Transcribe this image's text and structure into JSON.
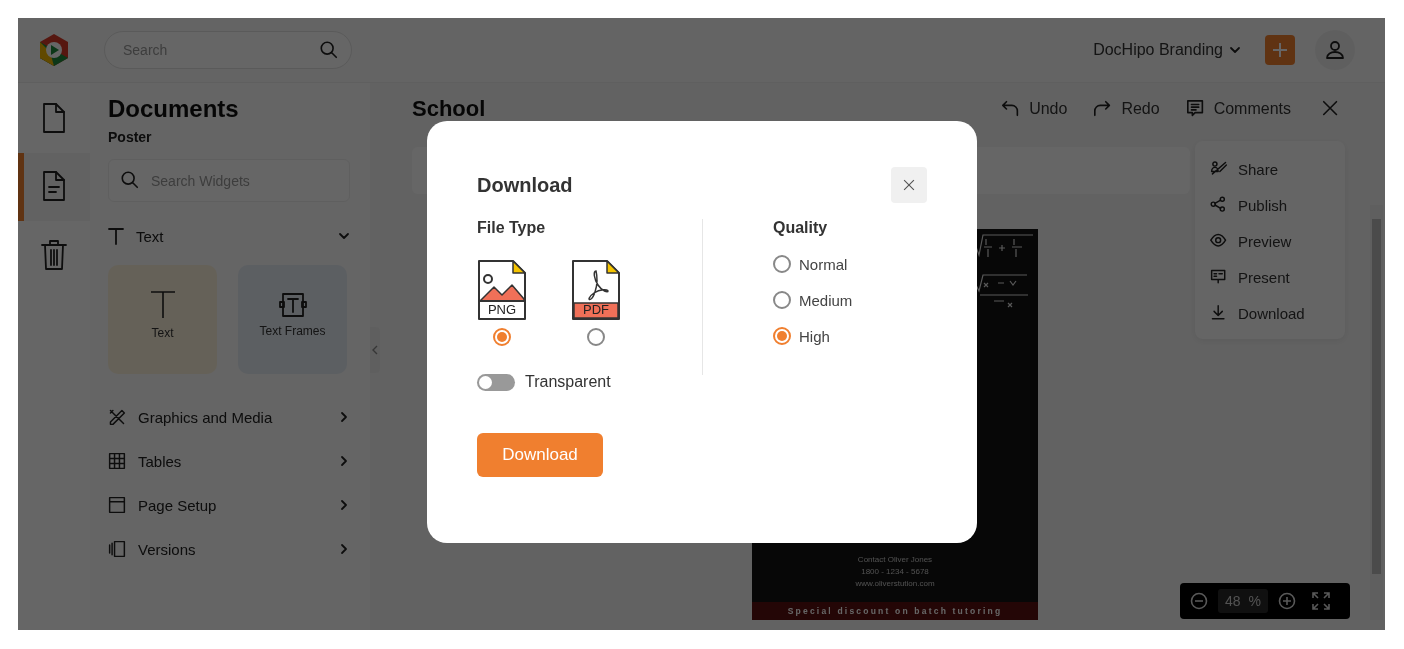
{
  "header": {
    "search": {
      "placeholder": "Search"
    },
    "workspace": "DocHipo Branding"
  },
  "rail": [
    {
      "kind": "page",
      "selected": false
    },
    {
      "kind": "document",
      "selected": true
    },
    {
      "kind": "trash",
      "selected": false
    }
  ],
  "panel": {
    "title": "Documents",
    "subtitle": "Poster",
    "search": {
      "placeholder": "Search Widgets"
    },
    "section": {
      "label": "Text",
      "expanded": true,
      "cards": [
        {
          "kind": "text",
          "label": "Text"
        },
        {
          "kind": "frame",
          "label": "Text Frames"
        }
      ]
    },
    "items": [
      {
        "kind": "graphics",
        "label": "Graphics and Media"
      },
      {
        "kind": "tables",
        "label": "Tables"
      },
      {
        "kind": "page",
        "label": "Page Setup"
      },
      {
        "kind": "versions",
        "label": "Versions"
      }
    ]
  },
  "editor": {
    "title": "School",
    "actions": [
      {
        "kind": "undo",
        "label": "Undo"
      },
      {
        "kind": "redo",
        "label": "Redo"
      },
      {
        "kind": "comments",
        "label": "Comments"
      }
    ],
    "menu": [
      {
        "kind": "share",
        "label": "Share"
      },
      {
        "kind": "publish",
        "label": "Publish"
      },
      {
        "kind": "preview",
        "label": "Preview"
      },
      {
        "kind": "present",
        "label": "Present"
      },
      {
        "kind": "download",
        "label": "Download"
      }
    ],
    "poster": {
      "lines": [
        "Contact Oliver Jones",
        "1800 - 1234 - 5678",
        "www.oliverstution.com"
      ],
      "banner": "Special discount on batch tutoring"
    },
    "zoom": {
      "value": "48",
      "unit": "%"
    }
  },
  "dialog": {
    "title": "Download",
    "file_type": {
      "label": "File Type",
      "options": [
        {
          "kind": "png",
          "label": "PNG",
          "selected": true
        },
        {
          "kind": "pdf",
          "label": "PDF",
          "selected": false
        }
      ]
    },
    "transparent": {
      "label": "Transparent",
      "on": false
    },
    "quality": {
      "label": "Quality",
      "options": [
        {
          "label": "Normal",
          "selected": false
        },
        {
          "label": "Medium",
          "selected": false
        },
        {
          "label": "High",
          "selected": true
        }
      ]
    },
    "button": "Download"
  }
}
